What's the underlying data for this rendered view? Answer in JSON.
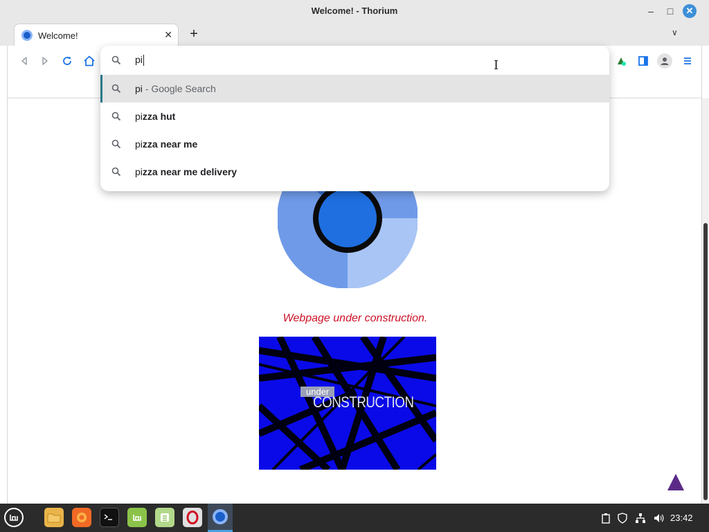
{
  "window": {
    "title": "Welcome! - Thorium",
    "controls": {
      "minimize": "–",
      "maximize": "□",
      "close": "✕"
    }
  },
  "tabs": [
    {
      "label": "Welcome!",
      "close": "✕"
    }
  ],
  "tabstrip": {
    "new_tab": "+",
    "tab_menu": "∨"
  },
  "toolbar": {
    "icons": [
      "back-icon",
      "forward-icon",
      "reload-icon",
      "home-icon",
      "extension-icon",
      "side-panel-icon",
      "profile-icon",
      "menu-icon"
    ]
  },
  "omnibox": {
    "value": "pi",
    "suggestions": [
      {
        "match": "pi",
        "rest": "",
        "suffix": " - Google Search"
      },
      {
        "match": "pi",
        "rest": "zza hut",
        "suffix": ""
      },
      {
        "match": "pi",
        "rest": "zza near me",
        "suffix": ""
      },
      {
        "match": "pi",
        "rest": "zza near me delivery",
        "suffix": ""
      }
    ]
  },
  "page": {
    "construction_message": "Webpage under construction.",
    "image_text_under": "under",
    "image_text_construction": "CONSTRUCTION"
  },
  "taskbar": {
    "apps": [
      "menu-icon",
      "files-icon",
      "firefox-icon",
      "terminal-icon",
      "software-manager-icon",
      "calculator-icon",
      "opera-icon",
      "thorium-icon"
    ],
    "clock": "23:42"
  },
  "colors": {
    "accent": "#1a73e8",
    "construction_red": "#cc1126",
    "construction_blue": "#0a0ae8",
    "taskbar_bg": "#2b2b2b"
  }
}
